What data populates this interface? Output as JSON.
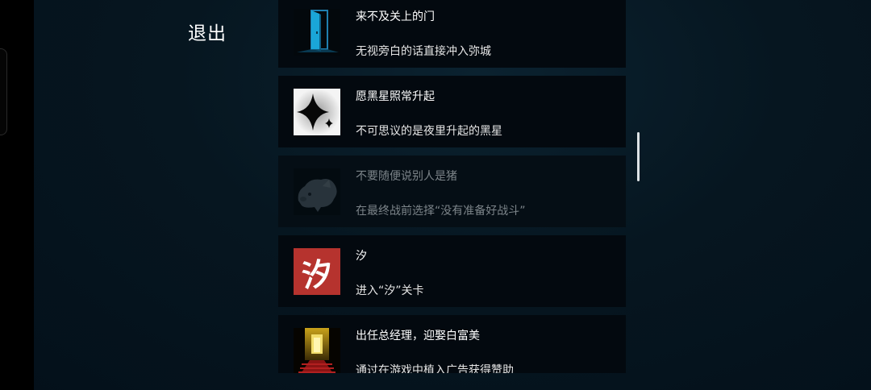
{
  "header": {
    "exit_label": "退出"
  },
  "achievements": [
    {
      "title": "来不及关上的门",
      "description": "无视旁白的话直接冲入弥城",
      "icon": "open-door-icon",
      "locked": false
    },
    {
      "title": "愿黑星照常升起",
      "description": "不可思议的是夜里升起的黑星",
      "icon": "black-star-icon",
      "locked": false
    },
    {
      "title": "不要随便说别人是猪",
      "description": "在最终战前选择“没有准备好战斗”",
      "icon": "pig-icon",
      "locked": true
    },
    {
      "title": "汐",
      "description": "进入“汐”关卡",
      "icon": "xi-character-icon",
      "icon_text": "汐",
      "locked": false
    },
    {
      "title": "出任总经理，迎娶白富美",
      "description": "通过在游戏中植入广告获得赞助",
      "icon": "red-carpet-icon",
      "locked": false
    }
  ],
  "colors": {
    "background": "#061620",
    "card": "#03090f",
    "text": "#ffffff",
    "locked_text": "#7c8489",
    "xi_red": "#b6332e"
  }
}
